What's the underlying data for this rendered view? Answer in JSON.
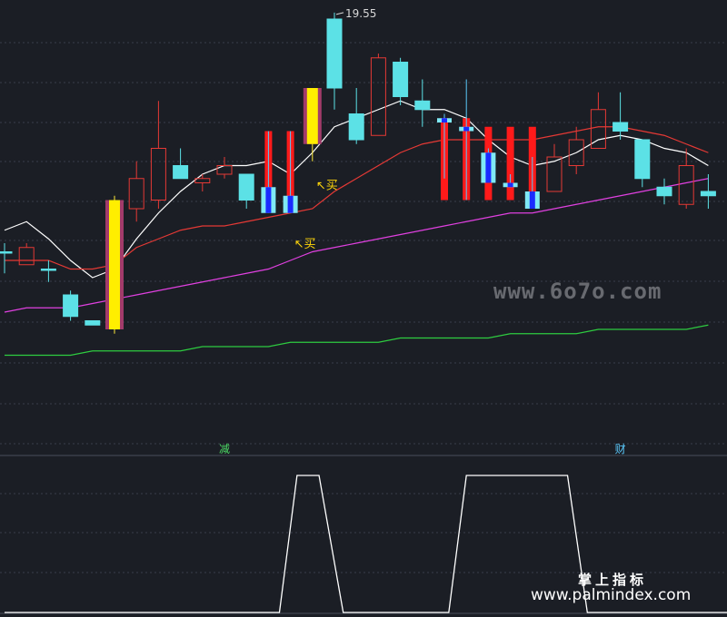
{
  "chart_data": [
    {
      "type": "candlestick",
      "title": "",
      "ylim": [
        11,
        19.8
      ],
      "high_label": "19.55",
      "candles": [
        {
          "o": 14.0,
          "h": 14.2,
          "l": 13.5,
          "c": 14.0,
          "style": "cyan"
        },
        {
          "o": 13.7,
          "h": 14.2,
          "l": 13.7,
          "c": 14.1,
          "style": "red"
        },
        {
          "o": 13.6,
          "h": 13.8,
          "l": 13.3,
          "c": 13.6,
          "style": "cyan"
        },
        {
          "o": 13.0,
          "h": 13.1,
          "l": 12.4,
          "c": 12.5,
          "style": "cyan"
        },
        {
          "o": 12.4,
          "h": 12.4,
          "l": 12.3,
          "c": 12.3,
          "style": "cyan"
        },
        {
          "o": 12.2,
          "h": 15.3,
          "l": 12.1,
          "c": 15.2,
          "style": "signal"
        },
        {
          "o": 15.0,
          "h": 16.1,
          "l": 14.7,
          "c": 15.7,
          "style": "red"
        },
        {
          "o": 15.2,
          "h": 17.5,
          "l": 15.0,
          "c": 16.4,
          "style": "red"
        },
        {
          "o": 16.0,
          "h": 16.4,
          "l": 15.9,
          "c": 15.7,
          "style": "cyan"
        },
        {
          "o": 15.6,
          "h": 15.8,
          "l": 15.4,
          "c": 15.7,
          "style": "red"
        },
        {
          "o": 15.8,
          "h": 16.2,
          "l": 15.7,
          "c": 16.0,
          "style": "red"
        },
        {
          "o": 15.8,
          "h": 15.8,
          "l": 15.0,
          "c": 15.2,
          "style": "cyan"
        },
        {
          "o": 15.2,
          "h": 16.8,
          "l": 14.9,
          "c": 15.0,
          "style": "bar",
          "bar_top": 16.8,
          "bar_bottom": 15.0,
          "body": [
            14.9,
            15.5
          ],
          "bar_color": "red"
        },
        {
          "o": 15.0,
          "h": 16.8,
          "l": 14.9,
          "c": 15.0,
          "style": "bar",
          "bar_top": 16.8,
          "bar_bottom": 15.0,
          "body": [
            14.9,
            15.3
          ],
          "bar_color": "red"
        },
        {
          "o": 16.5,
          "h": 17.8,
          "l": 16.1,
          "c": 17.8,
          "style": "signal"
        },
        {
          "o": 17.8,
          "h": 19.55,
          "l": 17.3,
          "c": 19.4,
          "style": "cyan"
        },
        {
          "o": 17.2,
          "h": 17.8,
          "l": 16.5,
          "c": 16.6,
          "style": "cyan"
        },
        {
          "o": 16.7,
          "h": 18.6,
          "l": 16.7,
          "c": 18.5,
          "style": "red"
        },
        {
          "o": 18.4,
          "h": 18.5,
          "l": 17.4,
          "c": 17.6,
          "style": "cyan"
        },
        {
          "o": 17.5,
          "h": 18.0,
          "l": 16.9,
          "c": 17.3,
          "style": "cyan"
        },
        {
          "o": 17.2,
          "h": 17.2,
          "l": 15.7,
          "c": 17.1,
          "style": "bar",
          "bar_top": 17.1,
          "bar_bottom": 15.2,
          "body": [
            17.0,
            17.1
          ],
          "bar_color": "red"
        },
        {
          "o": 16.9,
          "h": 18.0,
          "l": 15.2,
          "c": 16.9,
          "style": "bar",
          "bar_top": 17.1,
          "bar_bottom": 15.2,
          "body": [
            16.8,
            16.9
          ],
          "bar_color": "red"
        },
        {
          "o": 16.3,
          "h": 16.4,
          "l": 15.6,
          "c": 15.6,
          "style": "bar",
          "bar_top": 16.9,
          "bar_bottom": 15.2,
          "body": [
            15.6,
            16.3
          ],
          "bar_color": "red"
        },
        {
          "o": 15.6,
          "h": 15.8,
          "l": 15.5,
          "c": 15.6,
          "style": "bar",
          "bar_top": 16.9,
          "bar_bottom": 15.2,
          "body": [
            15.5,
            15.6
          ],
          "bar_color": "red"
        },
        {
          "o": 15.4,
          "h": 16.2,
          "l": 15.1,
          "c": 15.0,
          "style": "bar",
          "bar_top": 16.9,
          "bar_bottom": 15.2,
          "body": [
            15.0,
            15.4
          ],
          "bar_color": "red"
        },
        {
          "o": 15.4,
          "h": 16.5,
          "l": 15.4,
          "c": 16.2,
          "style": "red"
        },
        {
          "o": 16.0,
          "h": 16.9,
          "l": 15.8,
          "c": 16.6,
          "style": "red"
        },
        {
          "o": 16.4,
          "h": 17.7,
          "l": 16.4,
          "c": 17.3,
          "style": "red"
        },
        {
          "o": 17.0,
          "h": 17.7,
          "l": 16.6,
          "c": 16.8,
          "style": "cyan"
        },
        {
          "o": 16.6,
          "h": 16.6,
          "l": 15.5,
          "c": 15.7,
          "style": "cyan"
        },
        {
          "o": 15.5,
          "h": 15.7,
          "l": 15.1,
          "c": 15.3,
          "style": "cyan"
        },
        {
          "o": 15.1,
          "h": 16.4,
          "l": 15.0,
          "c": 16.0,
          "style": "red"
        },
        {
          "o": 15.4,
          "h": 15.8,
          "l": 15.0,
          "c": 15.3,
          "style": "cyan"
        }
      ],
      "series": [
        {
          "color": "#ffffff",
          "values": [
            14.5,
            14.7,
            14.3,
            13.8,
            13.4,
            13.6,
            14.3,
            14.9,
            15.4,
            15.8,
            16.0,
            16.0,
            16.1,
            15.8,
            16.3,
            16.9,
            17.1,
            17.3,
            17.5,
            17.3,
            17.3,
            17.1,
            16.6,
            16.2,
            16.0,
            16.1,
            16.3,
            16.6,
            16.7,
            16.6,
            16.4,
            16.3,
            16.0
          ]
        },
        {
          "color": "#e53935",
          "values": [
            13.8,
            13.8,
            13.8,
            13.6,
            13.6,
            13.7,
            14.1,
            14.3,
            14.5,
            14.6,
            14.6,
            14.7,
            14.8,
            14.9,
            15.0,
            15.4,
            15.7,
            16.0,
            16.3,
            16.5,
            16.6,
            16.6,
            16.6,
            16.6,
            16.6,
            16.7,
            16.8,
            16.9,
            16.9,
            16.8,
            16.7,
            16.5,
            16.3
          ]
        },
        {
          "color": "#e040e0",
          "values": [
            12.6,
            12.7,
            12.7,
            12.7,
            12.8,
            12.9,
            13.0,
            13.1,
            13.2,
            13.3,
            13.4,
            13.5,
            13.6,
            13.8,
            14.0,
            14.1,
            14.2,
            14.3,
            14.4,
            14.5,
            14.6,
            14.7,
            14.8,
            14.9,
            14.9,
            15.0,
            15.1,
            15.2,
            15.3,
            15.4,
            15.5,
            15.6,
            15.7
          ]
        },
        {
          "color": "#2ecc40",
          "values": [
            11.6,
            11.6,
            11.6,
            11.6,
            11.7,
            11.7,
            11.7,
            11.7,
            11.7,
            11.8,
            11.8,
            11.8,
            11.8,
            11.9,
            11.9,
            11.9,
            11.9,
            11.9,
            12.0,
            12.0,
            12.0,
            12.0,
            12.0,
            12.1,
            12.1,
            12.1,
            12.1,
            12.2,
            12.2,
            12.2,
            12.2,
            12.2,
            12.3
          ]
        }
      ],
      "annotations": [
        {
          "text": "买",
          "index": 14,
          "value": 15.45
        },
        {
          "text": "买",
          "index": 13,
          "value": 14.1
        }
      ],
      "markers": [
        {
          "text": "减",
          "index": 10,
          "color": "#4cd964"
        },
        {
          "text": "财",
          "index": 28,
          "color": "#5ac8fa"
        }
      ]
    },
    {
      "type": "line",
      "ylim": [
        0,
        1
      ],
      "series": [
        {
          "color": "#ffffff",
          "points": [
            [
              0,
              0
            ],
            [
              12.5,
              0
            ],
            [
              13.3,
              1
            ],
            [
              14.3,
              1
            ],
            [
              15.4,
              0
            ],
            [
              20.2,
              0
            ],
            [
              21.0,
              1
            ],
            [
              25.6,
              1
            ],
            [
              26.5,
              0
            ],
            [
              32.9,
              0
            ]
          ]
        }
      ]
    }
  ],
  "watermarks": {
    "center": "www.6o7o.com",
    "footer_cn": "掌上指标",
    "footer_url": "www.palmindex.com"
  }
}
